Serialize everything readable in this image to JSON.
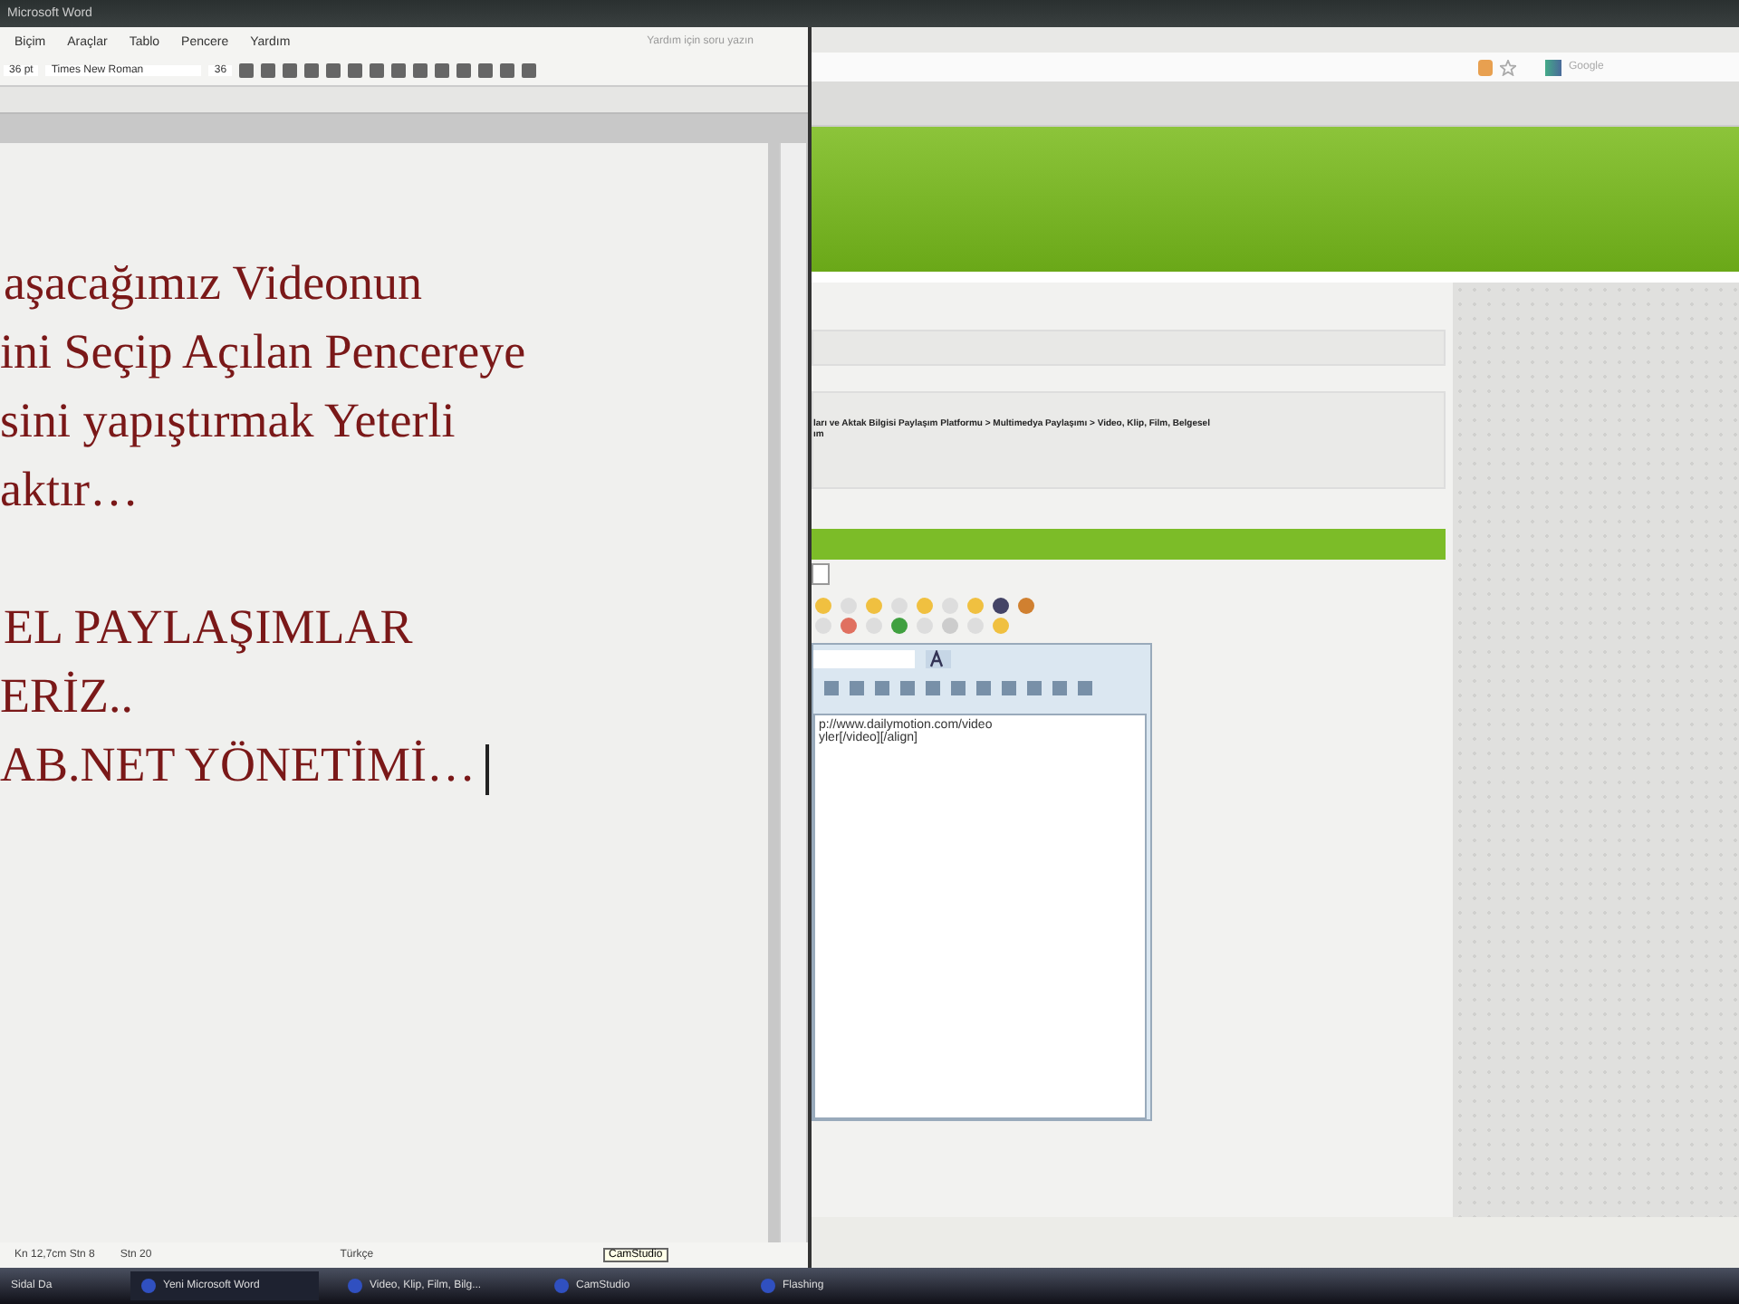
{
  "word_window": {
    "title": "Microsoft Word",
    "menu": [
      "Biçim",
      "Araçlar",
      "Tablo",
      "Pencere",
      "Yardım"
    ],
    "help_placeholder": "Yardım için soru yazın",
    "style": "36 pt",
    "font": "Times New Roman",
    "size": "36",
    "document_paragraphs": [
      [
        "aşacağımız Videonun",
        "ini Seçip Açılan Pencereye",
        "sini yapıştırmak Yeterli",
        "aktır…"
      ],
      [
        "EL PAYLAŞIMLAR",
        "ERİZ..",
        "AB.NET YÖNETİMİ…"
      ]
    ],
    "status": [
      "Kn 12,7cm Stn 8",
      "Stn 20",
      "Türkçe"
    ]
  },
  "browser": {
    "search_placeholder": "Google",
    "breadcrumb": "ları ve Aktak Bilgisi Paylaşım Platformu > Multimedya Paylaşımı > Video, Klip, Film, Belgesel",
    "breadcrumb_tail": "ım",
    "editor_lines": [
      "p://www.dailymotion.com/video",
      "yler[/video][/align]"
    ]
  },
  "tooltip": "CamStudio",
  "taskbar": [
    {
      "label": "Sidal Da",
      "selected": false
    },
    {
      "label": "Yeni Microsoft Word",
      "selected": true
    },
    {
      "label": "Video, Klip, Film, Bilg...",
      "selected": false
    },
    {
      "label": "CamStudio",
      "selected": false
    },
    {
      "label": "Flashing",
      "selected": false
    }
  ]
}
